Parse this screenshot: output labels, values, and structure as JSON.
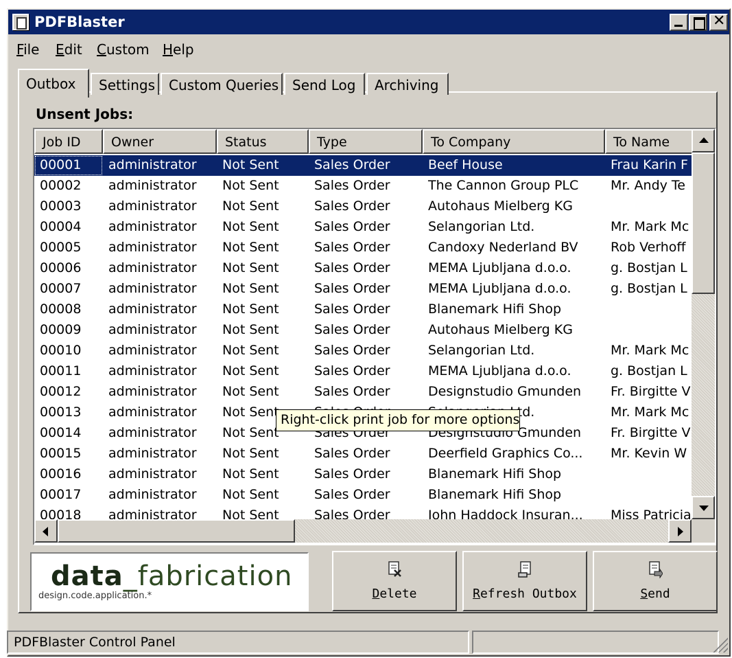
{
  "window": {
    "title": "PDFBlaster"
  },
  "menu": [
    {
      "label": "File",
      "accel": "F",
      "rest": "ile"
    },
    {
      "label": "Edit",
      "accel": "E",
      "rest": "dit"
    },
    {
      "label": "Custom",
      "accel": "C",
      "rest": "ustom"
    },
    {
      "label": "Help",
      "accel": "H",
      "rest": "elp"
    }
  ],
  "tabs": [
    "Outbox",
    "Settings",
    "Custom Queries",
    "Send Log",
    "Archiving"
  ],
  "active_tab": "Outbox",
  "outbox": {
    "section_label": "Unsent Jobs:",
    "columns": [
      "Job ID",
      "Owner",
      "Status",
      "Type",
      "To Company",
      "To Name"
    ],
    "rows": [
      [
        "00001",
        "administrator",
        "Not Sent",
        "Sales Order",
        "Beef House",
        "Frau Karin F"
      ],
      [
        "00002",
        "administrator",
        "Not Sent",
        "Sales Order",
        "The Cannon Group PLC",
        "Mr. Andy Te"
      ],
      [
        "00003",
        "administrator",
        "Not Sent",
        "Sales Order",
        "Autohaus Mielberg KG",
        ""
      ],
      [
        "00004",
        "administrator",
        "Not Sent",
        "Sales Order",
        "Selangorian Ltd.",
        "Mr. Mark Mc"
      ],
      [
        "00005",
        "administrator",
        "Not Sent",
        "Sales Order",
        "Candoxy Nederland BV",
        "Rob Verhoff"
      ],
      [
        "00006",
        "administrator",
        "Not Sent",
        "Sales Order",
        "MEMA Ljubljana d.o.o.",
        "g. Bostjan L"
      ],
      [
        "00007",
        "administrator",
        "Not Sent",
        "Sales Order",
        "MEMA Ljubljana d.o.o.",
        "g. Bostjan L"
      ],
      [
        "00008",
        "administrator",
        "Not Sent",
        "Sales Order",
        "Blanemark Hifi Shop",
        ""
      ],
      [
        "00009",
        "administrator",
        "Not Sent",
        "Sales Order",
        "Autohaus Mielberg KG",
        ""
      ],
      [
        "00010",
        "administrator",
        "Not Sent",
        "Sales Order",
        "Selangorian Ltd.",
        "Mr. Mark Mc"
      ],
      [
        "00011",
        "administrator",
        "Not Sent",
        "Sales Order",
        "MEMA Ljubljana d.o.o.",
        "g. Bostjan L"
      ],
      [
        "00012",
        "administrator",
        "Not Sent",
        "Sales Order",
        "Designstudio Gmunden",
        "Fr. Birgitte V"
      ],
      [
        "00013",
        "administrator",
        "Not Sent",
        "Sales Order",
        "Selangorian Ltd.",
        "Mr. Mark Mc"
      ],
      [
        "00014",
        "administrator",
        "Not Sent",
        "Sales Order",
        "Designstudio Gmunden",
        "Fr. Birgitte V"
      ],
      [
        "00015",
        "administrator",
        "Not Sent",
        "Sales Order",
        "Deerfield Graphics Co...",
        "Mr. Kevin W"
      ],
      [
        "00016",
        "administrator",
        "Not Sent",
        "Sales Order",
        "Blanemark Hifi Shop",
        ""
      ],
      [
        "00017",
        "administrator",
        "Not Sent",
        "Sales Order",
        "Blanemark Hifi Shop",
        ""
      ],
      [
        "00018",
        "administrator",
        "Not Sent",
        "Sales Order",
        "John Haddock Insuran...",
        "Miss Patricia"
      ]
    ],
    "selected_row": 0,
    "tooltip": "Right-click print job for more options"
  },
  "logo": {
    "brand_bold": "data",
    "brand_rest": "_fabrication",
    "tagline": "design.code.application.*"
  },
  "buttons": {
    "delete": {
      "label": "Delete",
      "accel": "D",
      "rest": "elete",
      "icon": "delete-document-icon"
    },
    "refresh": {
      "label": "Refresh Outbox",
      "accel": "R",
      "rest": "efresh Outbox",
      "icon": "refresh-document-icon"
    },
    "send": {
      "label": "Send",
      "accel": "S",
      "rest": "end",
      "icon": "send-document-icon"
    }
  },
  "statusbar": {
    "text": "PDFBlaster Control Panel",
    "pane2": ""
  },
  "colors": {
    "titlebar": "#0a246a",
    "face": "#d4d0c8",
    "selection": "#0a246a",
    "tooltip_bg": "#ffffe1"
  }
}
